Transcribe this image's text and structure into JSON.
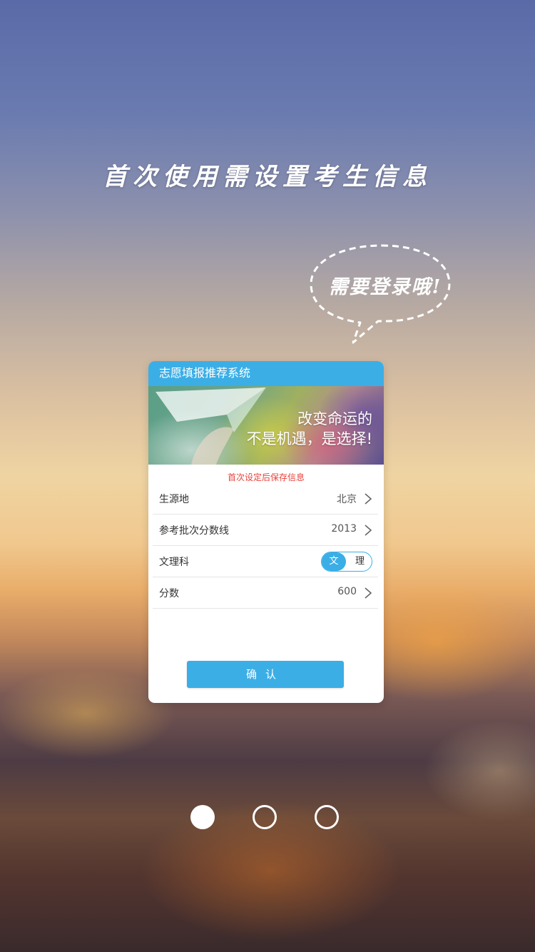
{
  "onboarding": {
    "headline": "首次使用需设置考生信息",
    "bubble_text": "需要登录哦!",
    "page_index": 1,
    "page_count": 3
  },
  "card": {
    "title": "志愿填报推荐系统",
    "banner_line1": "改变命运的",
    "banner_line2": "不是机遇，是选择!",
    "notice": "首次设定后保存信息",
    "rows": [
      {
        "label": "生源地",
        "value": "北京"
      },
      {
        "label": "参考批次分数线",
        "value": "2013"
      },
      {
        "label": "文理科",
        "toggle_on": "文",
        "toggle_off": "理"
      },
      {
        "label": "分数",
        "value": "600"
      }
    ],
    "confirm_label": "确认"
  },
  "colors": {
    "accent": "#3baee6",
    "notice": "#e8433c"
  },
  "icons": [
    "chevron-right-icon",
    "speech-bubble-icon",
    "paper-plane-icon"
  ]
}
